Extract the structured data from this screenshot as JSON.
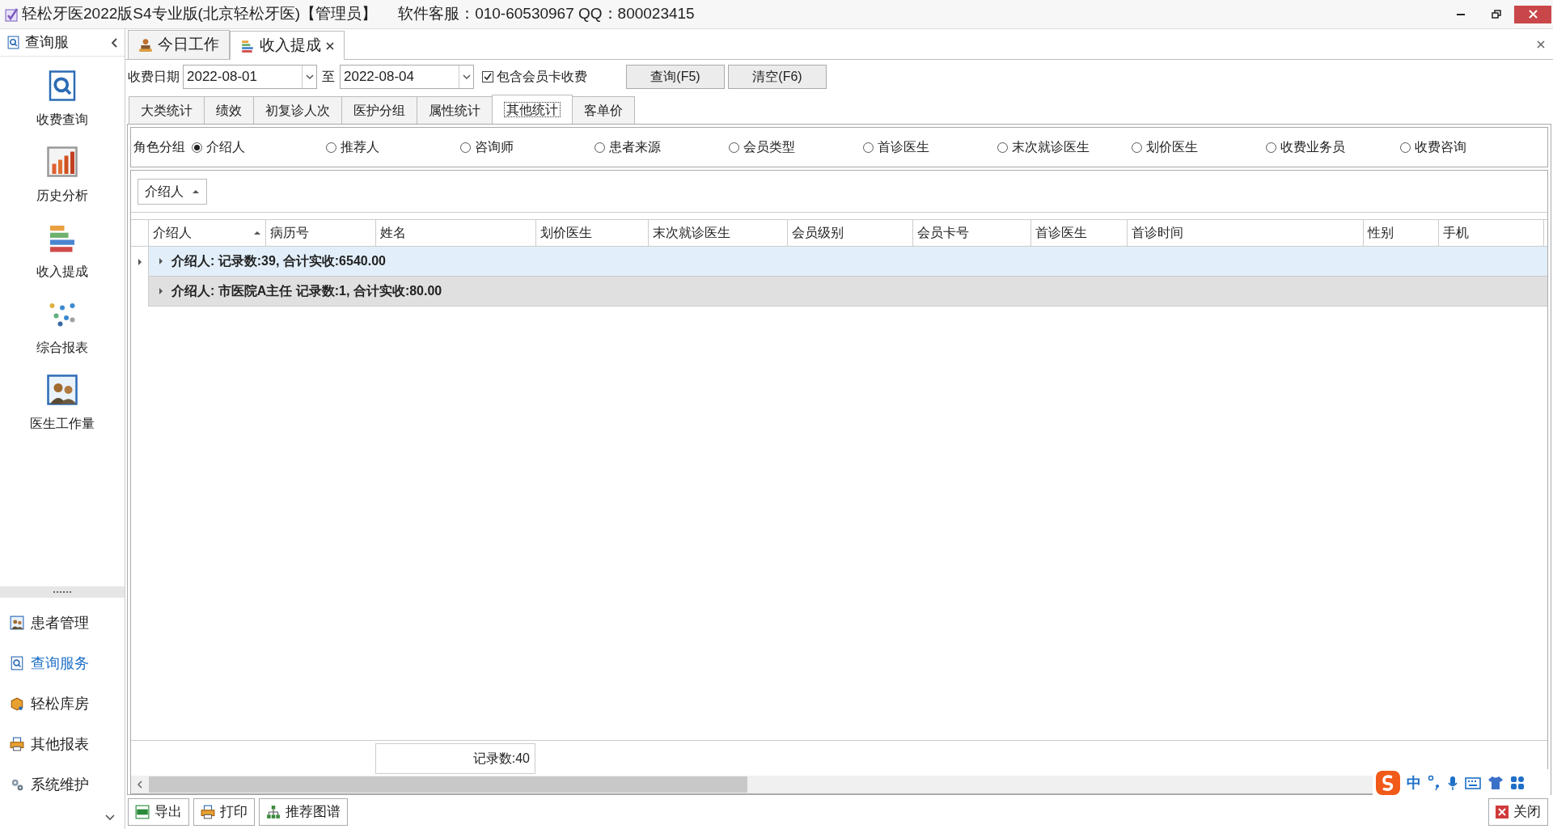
{
  "title_bar": {
    "title": "轻松牙医2022版S4专业版(北京轻松牙医)【管理员】",
    "support": "软件客服：010-60530967 QQ：800023415"
  },
  "sidebar": {
    "header": "查询服",
    "large_items": [
      {
        "kind": "search",
        "label": "收费查询"
      },
      {
        "kind": "history",
        "label": "历史分析"
      },
      {
        "kind": "bars",
        "label": "收入提成"
      },
      {
        "kind": "dots",
        "label": "综合报表"
      },
      {
        "kind": "people",
        "label": "医生工作量"
      }
    ],
    "bottom_items": [
      {
        "kind": "people",
        "label": "患者管理",
        "selected": false
      },
      {
        "kind": "search",
        "label": "查询服务",
        "selected": true
      },
      {
        "kind": "box",
        "label": "轻松库房",
        "selected": false
      },
      {
        "kind": "printer",
        "label": "其他报表",
        "selected": false
      },
      {
        "kind": "gear",
        "label": "系统维护",
        "selected": false
      }
    ]
  },
  "document_tabs": [
    {
      "kind": "work",
      "label": "今日工作",
      "selected": false,
      "closable": false
    },
    {
      "kind": "bars",
      "label": "收入提成",
      "selected": true,
      "closable": true
    }
  ],
  "filter": {
    "label": "收费日期",
    "start": "2022-08-01",
    "to": "至",
    "end": "2022-08-04",
    "include_card": {
      "label": "包含会员卡收费",
      "checked": true
    },
    "buttons": [
      "查询(F5)",
      "清空(F6)"
    ]
  },
  "sub_tabs": [
    {
      "label": "大类统计",
      "selected": false
    },
    {
      "label": "绩效",
      "selected": false
    },
    {
      "label": "初复诊人次",
      "selected": false
    },
    {
      "label": "医护分组",
      "selected": false
    },
    {
      "label": "属性统计",
      "selected": false
    },
    {
      "label": "其他统计",
      "selected": true
    },
    {
      "label": "客单价",
      "selected": false
    }
  ],
  "role_group": {
    "label": "角色分组",
    "options": [
      {
        "label": "介绍人",
        "selected": true
      },
      {
        "label": "推荐人",
        "selected": false
      },
      {
        "label": "咨询师",
        "selected": false
      },
      {
        "label": "患者来源",
        "selected": false
      },
      {
        "label": "会员类型",
        "selected": false
      },
      {
        "label": "首诊医生",
        "selected": false
      },
      {
        "label": "末次就诊医生",
        "selected": false
      },
      {
        "label": "划价医生",
        "selected": false
      },
      {
        "label": "收费业务员",
        "selected": false
      },
      {
        "label": "收费咨询",
        "selected": false
      }
    ]
  },
  "group_panel": {
    "chip": "介绍人"
  },
  "table": {
    "columns": [
      {
        "label": "介绍人",
        "sorted": true
      },
      {
        "label": "病历号",
        "sorted": false
      },
      {
        "label": "姓名",
        "sorted": false
      },
      {
        "label": "划价医生",
        "sorted": false
      },
      {
        "label": "末次就诊医生",
        "sorted": false
      },
      {
        "label": "会员级别",
        "sorted": false
      },
      {
        "label": "会员卡号",
        "sorted": false
      },
      {
        "label": "首诊医生",
        "sorted": false
      },
      {
        "label": "首诊时间",
        "sorted": false
      },
      {
        "label": "性别",
        "sorted": false
      },
      {
        "label": "手机",
        "sorted": false
      }
    ],
    "group_rows": [
      {
        "text": "介绍人: 记录数:39, 合计实收:6540.00",
        "selected": true
      },
      {
        "text": "介绍人: 市医院A主任 记录数:1, 合计实收:80.00",
        "selected": false
      }
    ],
    "footer": "记录数:40"
  },
  "bottom_buttons": [
    {
      "kind": "excel",
      "label": "导出"
    },
    {
      "kind": "printer",
      "label": "打印"
    },
    {
      "kind": "tree",
      "label": "推荐图谱"
    }
  ],
  "close_button": "关闭",
  "ime": {
    "label": "中"
  }
}
